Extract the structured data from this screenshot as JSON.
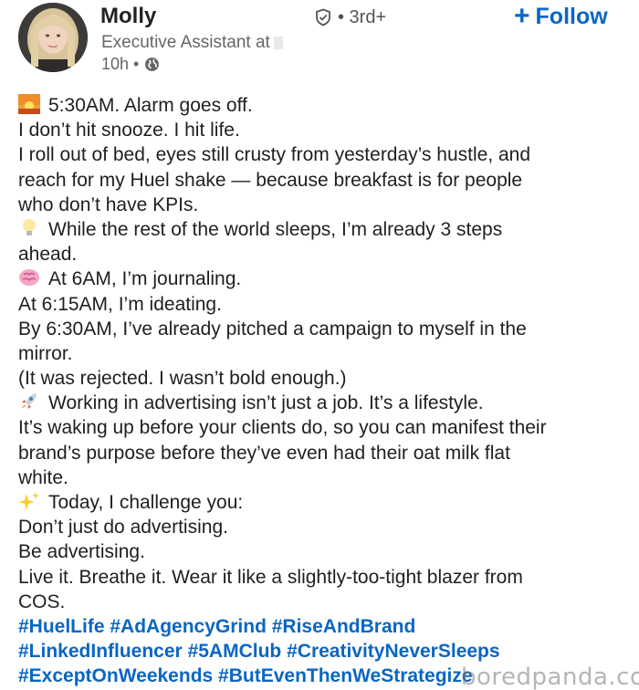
{
  "profile": {
    "name": "Molly",
    "degree": "• 3rd+",
    "headline": "Executive Assistant at",
    "time": "10h •",
    "follow_label": "Follow",
    "follow_plus": "+"
  },
  "post": {
    "lines": [
      {
        "emoji": "sunrise-icon",
        "text": "5:30AM. Alarm goes off."
      },
      {
        "text": "I don’t hit snooze. I hit life."
      },
      {
        "text": "I roll out of bed, eyes still crusty from yesterday’s hustle, and"
      },
      {
        "text": "reach for my Huel shake — because breakfast is for people"
      },
      {
        "text": "who don’t have KPIs."
      },
      {
        "emoji": "lightbulb-icon",
        "text": "While the rest of the world sleeps, I’m already 3 steps"
      },
      {
        "text": "ahead."
      },
      {
        "emoji": "brain-icon",
        "text": "At 6AM, I’m journaling."
      },
      {
        "text": "At 6:15AM, I’m ideating."
      },
      {
        "text": "By 6:30AM, I’ve already pitched a campaign to myself in the"
      },
      {
        "text": "mirror."
      },
      {
        "text": "(It was rejected. I wasn’t bold enough.)"
      },
      {
        "emoji": "rocket-icon",
        "text": "Working in advertising isn’t just a job. It’s a lifestyle."
      },
      {
        "text": "It’s waking up before your clients do, so you can manifest their"
      },
      {
        "text": "brand’s purpose before they’ve even had their oat milk flat"
      },
      {
        "text": "white."
      },
      {
        "emoji": "sparkles-icon",
        "text": "Today, I challenge you:"
      },
      {
        "text": "Don’t just do advertising."
      },
      {
        "text": "Be advertising."
      },
      {
        "text": "Live it. Breathe it. Wear it like a slightly-too-tight blazer from"
      },
      {
        "text": "COS."
      }
    ],
    "hashtag_lines": [
      [
        "#HuelLife",
        "#AdAgencyGrind",
        "#RiseAndBrand"
      ],
      [
        "#LinkedInfluencer",
        "#5AMClub",
        "#CreativityNeverSleeps"
      ],
      [
        "#ExceptOnWeekends",
        "#ButEvenThenWeStrategize"
      ]
    ]
  },
  "watermark": "boredpanda.com",
  "colors": {
    "link": "#0a66c2",
    "text": "#1f1f1f",
    "muted": "#666666"
  }
}
